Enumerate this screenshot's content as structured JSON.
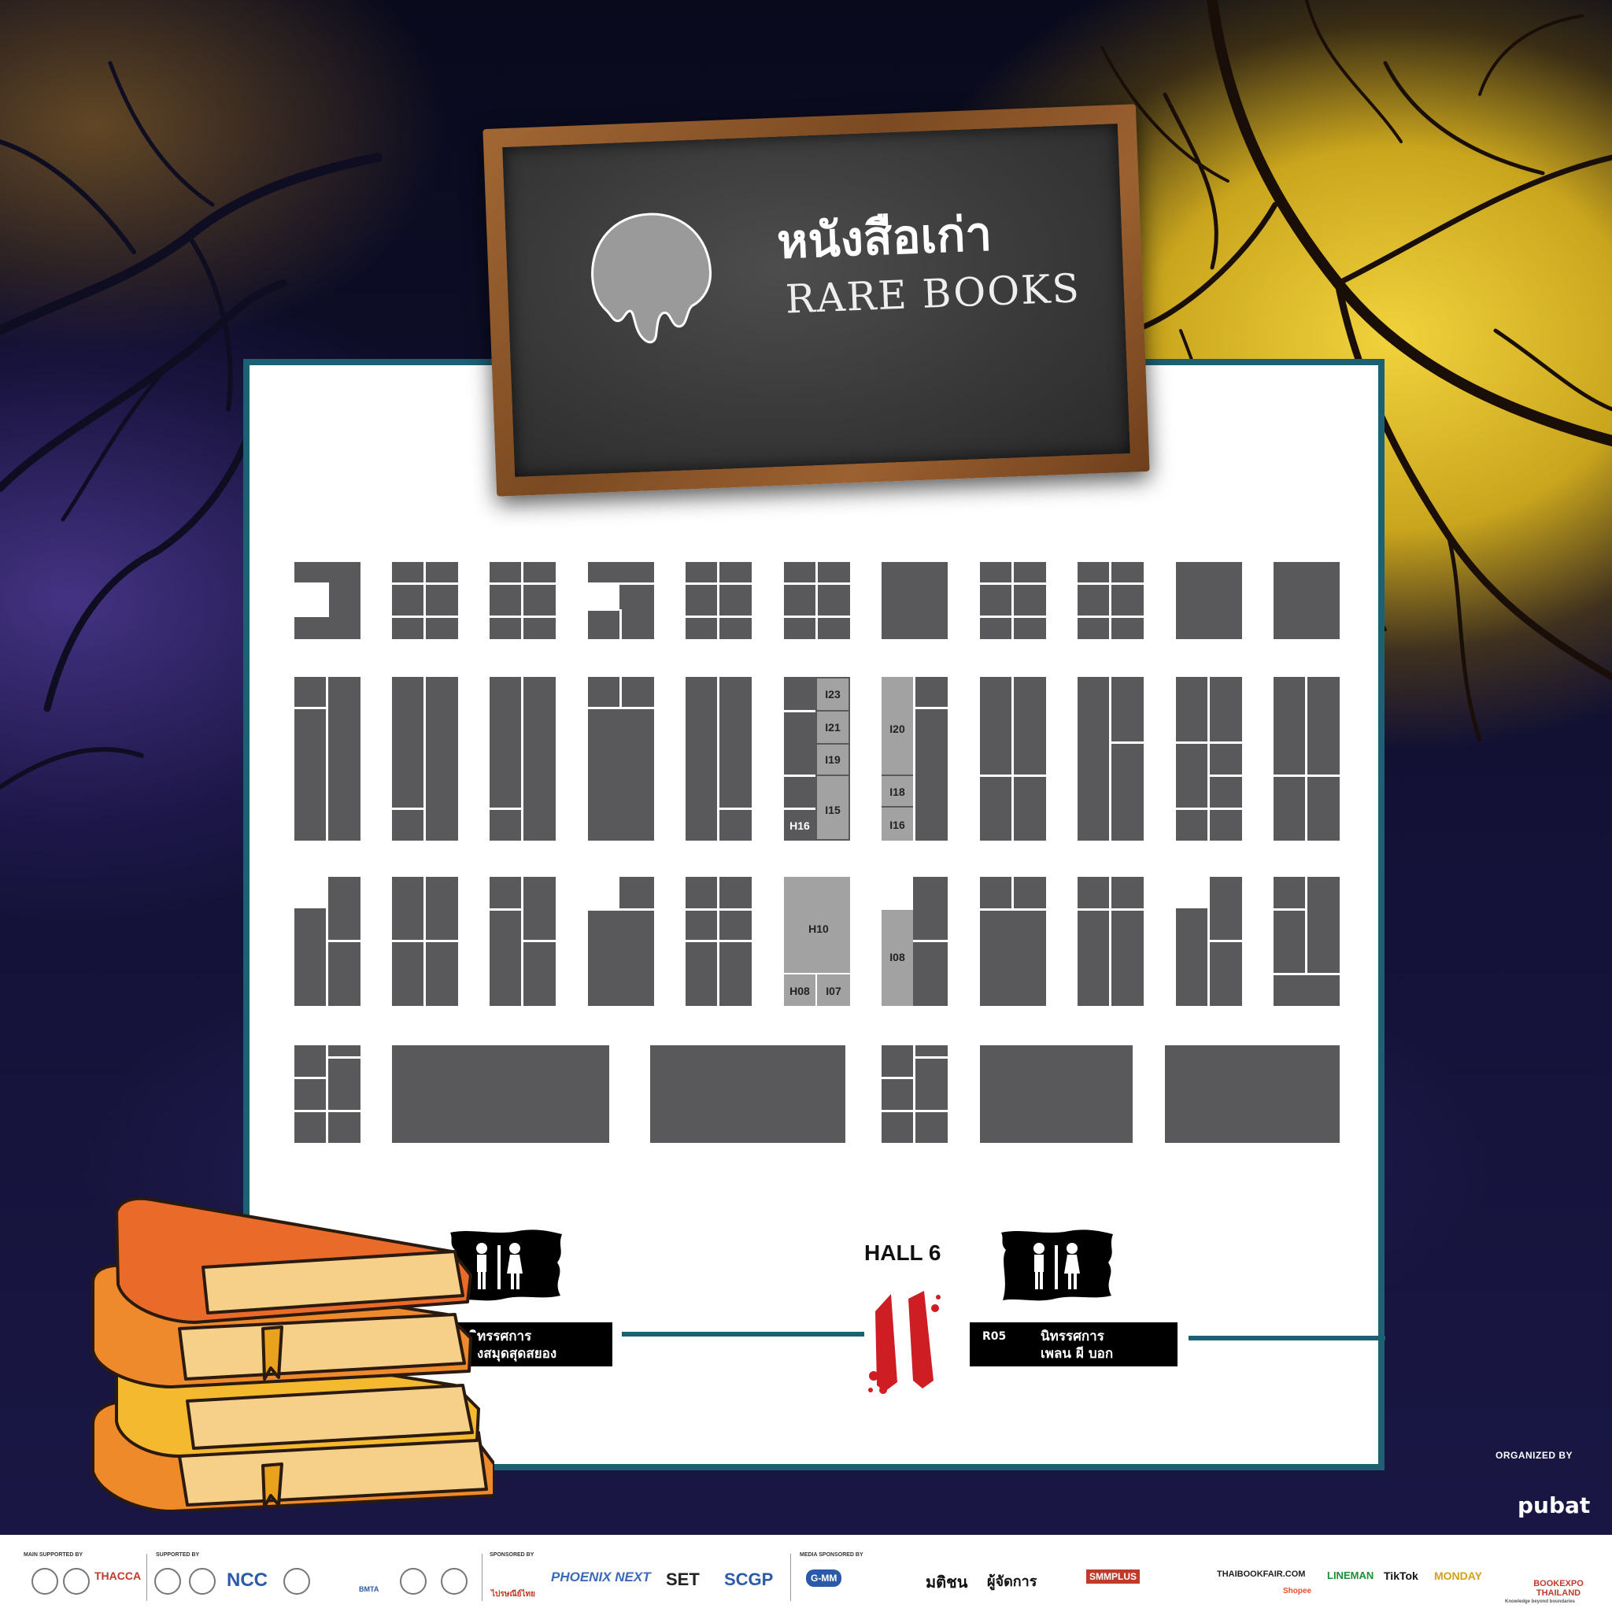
{
  "board": {
    "title_th": "หนังสือเก่า",
    "title_en": "RARE BOOKS",
    "icon": "dripping-skull-icon"
  },
  "booth_labels": [
    "I23",
    "I21",
    "I19",
    "I15",
    "H16",
    "I20",
    "I18",
    "I16",
    "H10",
    "H08",
    "I07",
    "I08"
  ],
  "hall": {
    "label": "HALL 6",
    "entrance_icon": "blood-entrance-icon"
  },
  "restroom": {
    "icon": "restroom-flag-icon"
  },
  "signs": {
    "left": {
      "code": "",
      "line1": "ิทรรศการ",
      "line2": "งสมุดสุดสยอง"
    },
    "right": {
      "code": "R05",
      "line1": "นิทรรศการ",
      "line2": "เพลน ผี บอก"
    }
  },
  "organizer": {
    "label": "ORGANIZED BY",
    "logo": "pubat"
  },
  "footer": {
    "groups": [
      "MAIN SUPPORTED BY",
      "SUPPORTED BY",
      "SPONSORED BY",
      "MEDIA SPONSORED BY"
    ],
    "logos": {
      "thacca": "THACCA",
      "ncc": "NCC",
      "bmta": "BMTA",
      "thaipost": "ไปรษณีย์ไทย",
      "phoenix": "PHOENIX NEXT",
      "set": "SET",
      "scgp": "SCGP",
      "gmm": "G-MM",
      "matichon": "มติชน",
      "phoojadkarn": "ผู้จัดการ",
      "smmplus": "SMMPLUS",
      "thaibookfair": "THAIBOOKFAIR.COM",
      "shopee": "Shopee",
      "lineman": "LINEMAN",
      "tiktok": "TikTok",
      "monday": "MONDAY",
      "bookexpo": "BOOKEXPO THAILAND",
      "bookexpo_tag": "Knowledge beyond boundaries"
    }
  }
}
